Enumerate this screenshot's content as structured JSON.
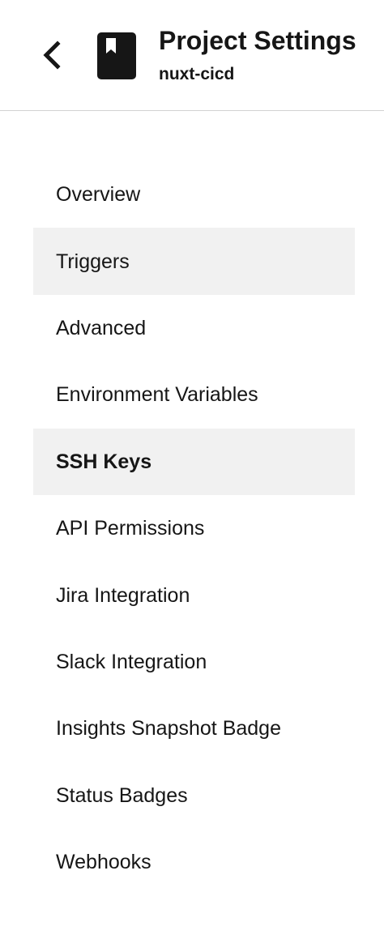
{
  "header": {
    "back_icon": "chevron-left-icon",
    "project_icon": "bookmark-book-icon",
    "title": "Project Settings",
    "subtitle": "nuxt-cicd"
  },
  "nav": {
    "items": [
      {
        "label": "Overview",
        "name": "nav-item-overview"
      },
      {
        "label": "Triggers",
        "name": "nav-item-triggers",
        "hovered": true
      },
      {
        "label": "Advanced",
        "name": "nav-item-advanced"
      },
      {
        "label": "Environment Variables",
        "name": "nav-item-environment-variables"
      },
      {
        "label": "SSH Keys",
        "name": "nav-item-ssh-keys",
        "active": true
      },
      {
        "label": "API Permissions",
        "name": "nav-item-api-permissions"
      },
      {
        "label": "Jira Integration",
        "name": "nav-item-jira-integration"
      },
      {
        "label": "Slack Integration",
        "name": "nav-item-slack-integration"
      },
      {
        "label": "Insights Snapshot Badge",
        "name": "nav-item-insights-snapshot-badge"
      },
      {
        "label": "Status Badges",
        "name": "nav-item-status-badges"
      },
      {
        "label": "Webhooks",
        "name": "nav-item-webhooks"
      }
    ]
  },
  "colors": {
    "text": "#161616",
    "highlight_background": "#f1f1f1",
    "divider": "#d2d2d2"
  }
}
